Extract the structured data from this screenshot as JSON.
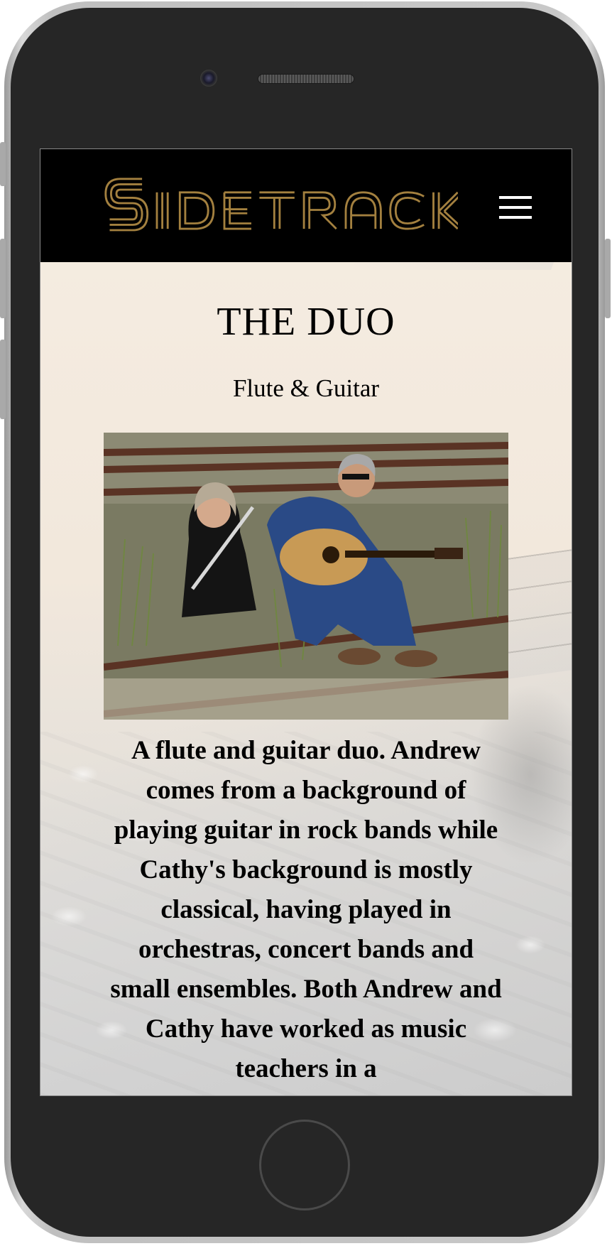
{
  "header": {
    "logo_text": "SIDETRACK",
    "menu_label": "menu",
    "logo_color": "#a3803f",
    "background_color": "#000000"
  },
  "main": {
    "title": "THE DUO",
    "subtitle": "Flute & Guitar",
    "photo_alt": "Flute and guitar duo sitting on railway tracks",
    "description": "A flute and guitar duo. Andrew comes from a background of playing guitar in rock bands while Cathy's background is mostly classical, having played in orchestras, concert bands and small ensembles. Both Andrew and Cathy have worked as music teachers in a"
  },
  "colors": {
    "page_background": "#f3ece2",
    "text": "#000000",
    "phone_body": "#262626"
  },
  "icons": {
    "menu": "hamburger-icon",
    "camera": "camera-icon",
    "speaker": "speaker-icon",
    "home": "home-button-icon"
  }
}
